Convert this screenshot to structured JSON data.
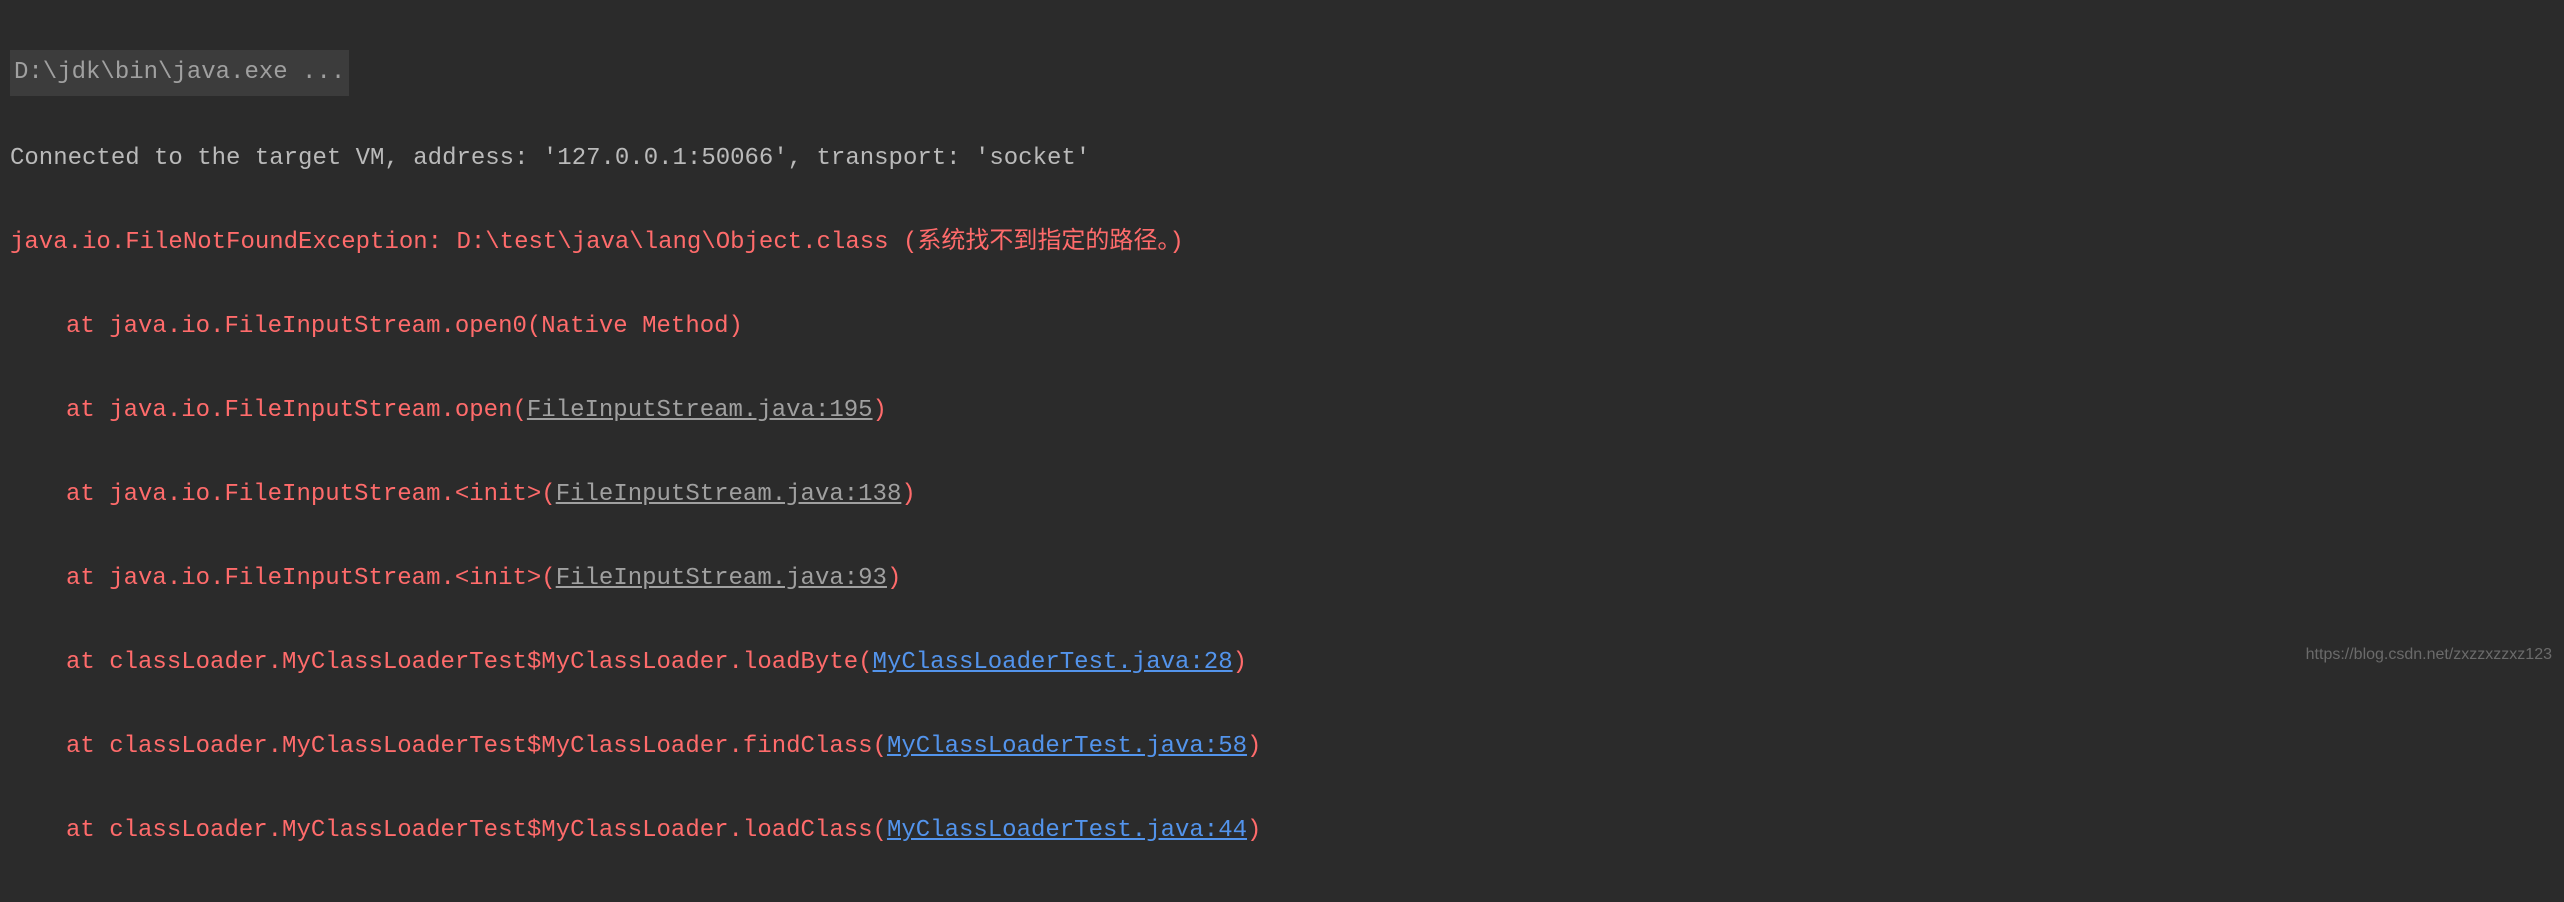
{
  "command": "D:\\jdk\\bin\\java.exe ...",
  "connected": "Connected to the target VM, address: '127.0.0.1:50066', transport: 'socket'",
  "exception": {
    "prefix": "java.io.FileNotFoundException: D:\\test\\java\\lang\\Object.class (系统找不到指定的路径。)",
    "at": "at ",
    "frames": [
      {
        "method": "java.io.FileInputStream.open0",
        "location": "Native Method",
        "type": "plain"
      },
      {
        "method": "java.io.FileInputStream.open",
        "location": "FileInputStream.java:195",
        "type": "gray"
      },
      {
        "method": "java.io.FileInputStream.<init>",
        "location": "FileInputStream.java:138",
        "type": "gray"
      },
      {
        "method": "java.io.FileInputStream.<init>",
        "location": "FileInputStream.java:93",
        "type": "gray"
      },
      {
        "method": "classLoader.MyClassLoaderTest$MyClassLoader.loadByte",
        "location": "MyClassLoaderTest.java:28",
        "type": "blue"
      },
      {
        "method": "classLoader.MyClassLoaderTest$MyClassLoader.findClass",
        "location": "MyClassLoaderTest.java:58",
        "type": "blue"
      },
      {
        "method": "classLoader.MyClassLoaderTest$MyClassLoader.loadClass",
        "location": "MyClassLoaderTest.java:44",
        "type": "blue"
      }
    ]
  },
  "watermark": "https://blog.csdn.net/zxzzxzzxz123"
}
